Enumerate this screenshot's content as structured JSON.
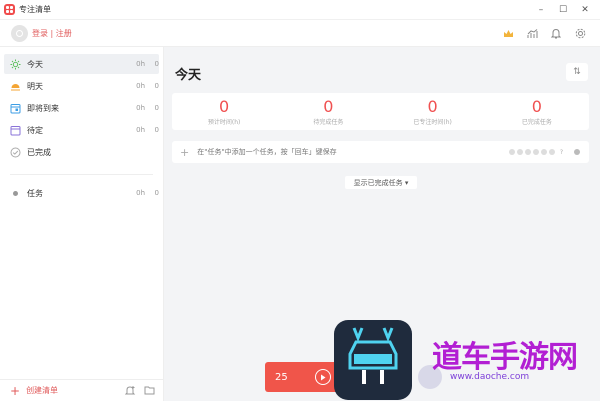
{
  "app": {
    "title": "专注清单"
  },
  "window": {
    "minimize": "–",
    "maximize": "☐",
    "close": "✕"
  },
  "header": {
    "login_text": "登录 | 注册"
  },
  "sidebar": {
    "items": [
      {
        "label": "今天",
        "time": "0h",
        "count": "0",
        "icon": "sun-icon"
      },
      {
        "label": "明天",
        "time": "0h",
        "count": "0",
        "icon": "sunrise-icon"
      },
      {
        "label": "即将到来",
        "time": "0h",
        "count": "0",
        "icon": "calendar-icon"
      },
      {
        "label": "待定",
        "time": "0h",
        "count": "0",
        "icon": "calendar-empty-icon"
      },
      {
        "label": "已完成",
        "time": "",
        "count": "",
        "icon": "check-circle-icon"
      }
    ],
    "lists": [
      {
        "label": "任务",
        "time": "0h",
        "count": "0"
      }
    ],
    "create_list": "创建清单"
  },
  "main": {
    "title": "今天",
    "stats": [
      {
        "value": "0",
        "label": "预计时间(h)"
      },
      {
        "value": "0",
        "label": "待完成任务"
      },
      {
        "value": "0",
        "label": "已专注时间(h)"
      },
      {
        "value": "0",
        "label": "已完成任务"
      }
    ],
    "add_task_placeholder": "在\"任务\"中添加一个任务，按「回车」键保存",
    "tomato_q": "?",
    "show_completed": "显示已完成任务 ▾"
  },
  "timer": {
    "value": "25"
  },
  "watermark": {
    "text": "道车手游网",
    "sub": "www.daoche.com"
  },
  "colors": {
    "accent": "#f05050",
    "watermark": "#b21fd3"
  }
}
